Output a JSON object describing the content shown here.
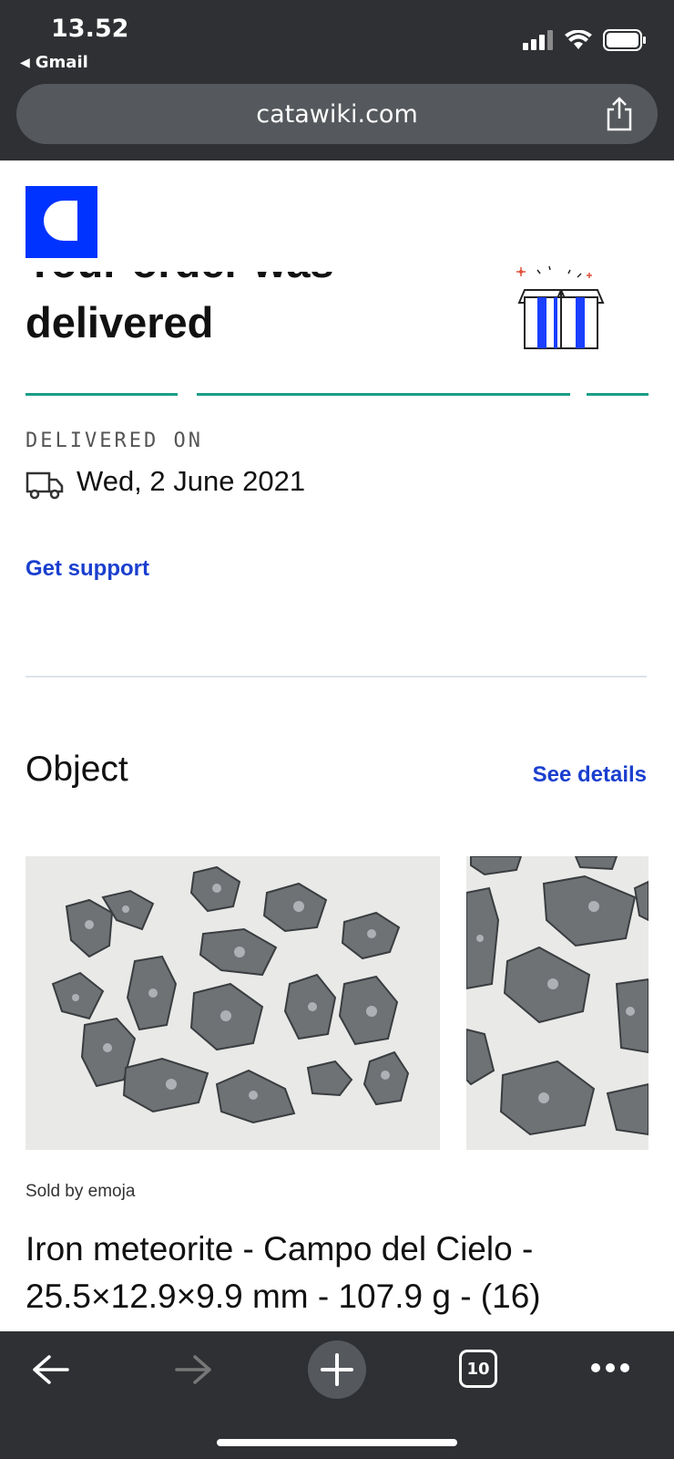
{
  "status_bar": {
    "time": "13.52",
    "back_app": "Gmail"
  },
  "browser": {
    "url": "catawiki.com",
    "tabs_count": "10"
  },
  "order": {
    "headline_line1": "Your order was",
    "headline_line2": "delivered",
    "delivered_label": "DELIVERED ON",
    "delivered_date": "Wed, 2 June 2021",
    "support_link": "Get support"
  },
  "object_section": {
    "title": "Object",
    "see_details": "See details",
    "sold_by": "Sold by emoja",
    "product_title": "Iron meteorite - Campo del Cielo - 25.5×12.9×9.9 mm - 107.9 g - (16)"
  },
  "colors": {
    "brand_blue": "#0033ff",
    "accent_teal": "#1a9e88",
    "link_blue": "#1a3fcf",
    "chrome_dark": "#2e3033"
  },
  "icons": [
    "signal-icon",
    "wifi-icon",
    "battery-icon",
    "share-icon",
    "truck-icon",
    "gift-icon",
    "back-arrow-icon",
    "forward-arrow-icon",
    "new-tab-icon",
    "tabs-icon",
    "more-icon"
  ]
}
